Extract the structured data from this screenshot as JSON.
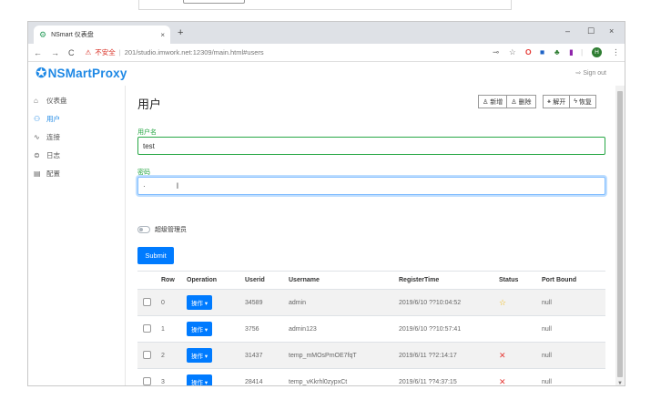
{
  "browser": {
    "tab_title": "NSmart 仪表盘",
    "tab_close": "×",
    "new_tab": "+",
    "win_min": "–",
    "win_max": "☐",
    "win_close": "×",
    "nav_back": "←",
    "nav_forward": "→",
    "nav_reload": "C",
    "security_warning": "不安全",
    "url_separator": "|",
    "url": "201/studio.imwork.net:12309/main.html#users"
  },
  "app": {
    "logo_text": "NSMartProxy",
    "signout_label": "Sign out"
  },
  "sidebar": {
    "items": [
      {
        "label": "仪表盘"
      },
      {
        "label": "用户"
      },
      {
        "label": "连接"
      },
      {
        "label": "日志"
      },
      {
        "label": "配置"
      }
    ]
  },
  "main": {
    "title": "用户",
    "toolbar": {
      "add_label": "新增",
      "delete_label": "删除",
      "unban_label": "解开",
      "restore_label": "恢复"
    },
    "form": {
      "username_label": "用户名",
      "username_value": "test",
      "password_label": "密码",
      "password_value": "·",
      "admin_label": "超级管理员",
      "submit_label": "Submit"
    },
    "table": {
      "headers": [
        "",
        "Row",
        "Operation",
        "Userid",
        "Username",
        "RegisterTime",
        "Status",
        "Port Bound"
      ],
      "op_label": "操作",
      "rows": [
        {
          "row": "0",
          "userid": "34589",
          "username": "admin",
          "time": "2019/6/10 ??10:04:52",
          "status": "star",
          "port": "null"
        },
        {
          "row": "1",
          "userid": "3756",
          "username": "admin123",
          "time": "2019/6/10 ??10:57:41",
          "status": "",
          "port": "null"
        },
        {
          "row": "2",
          "userid": "31437",
          "username": "temp_mMOsPmOE7fqT",
          "time": "2019/6/11 ??2:14:17",
          "status": "x",
          "port": "null"
        },
        {
          "row": "3",
          "userid": "28414",
          "username": "temp_vKkrhl0zypxCt",
          "time": "2019/6/11 ??4:37:15",
          "status": "x",
          "port": "null"
        }
      ]
    }
  },
  "colors": {
    "primary": "#007bff",
    "brand": "#1e88e5",
    "valid": "#28a745",
    "danger": "#e53935",
    "star": "#f0b400"
  }
}
